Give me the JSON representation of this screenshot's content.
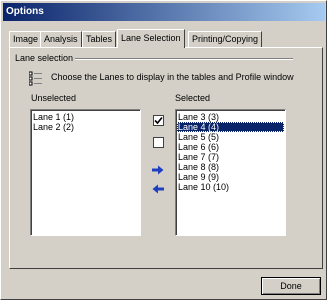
{
  "window": {
    "title": "Options"
  },
  "tabs": [
    {
      "label": "Image"
    },
    {
      "label": "Analysis"
    },
    {
      "label": "Tables"
    },
    {
      "label": "Lane Selection",
      "active": true
    },
    {
      "label": "Printing/Copying"
    }
  ],
  "lane_selection": {
    "group_title": "Lane selection",
    "instruction": "Choose the Lanes to display in the tables and Profile window",
    "unselected_label": "Unselected",
    "selected_label": "Selected",
    "unselected_items": [
      "Lane 1 (1)",
      "Lane 2 (2)"
    ],
    "selected_items": [
      "Lane 3 (3)",
      "Lane 4 (4)",
      "Lane 5 (5)",
      "Lane 6 (6)",
      "Lane 7 (7)",
      "Lane 8 (8)",
      "Lane 9 (9)",
      "Lane 10 (10)"
    ],
    "highlighted_item": "Lane 4 (4)",
    "icons": [
      "list-icon",
      "check-all-icon",
      "uncheck-all-icon",
      "move-right-arrow-icon",
      "move-left-arrow-icon"
    ]
  },
  "footer": {
    "done_label": "Done"
  },
  "colors": {
    "titlebar": "#0a246a",
    "selection": "#0a246a",
    "arrow": "#1f3fbf",
    "face": "#d4d0c8"
  }
}
